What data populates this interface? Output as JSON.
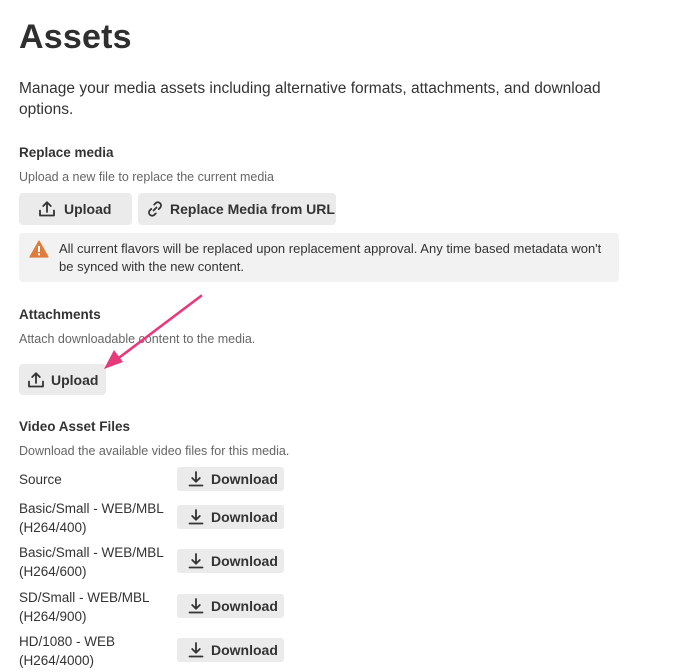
{
  "page": {
    "title": "Assets",
    "description": "Manage your media assets including alternative formats, attachments, and download options."
  },
  "replace_media": {
    "title": "Replace media",
    "description": "Upload a new file to replace the current media",
    "upload_label": "Upload",
    "url_label": "Replace Media from URL",
    "warning": "All current flavors will be replaced upon replacement approval. Any time based metadata won't be synced with the new content."
  },
  "attachments": {
    "title": "Attachments",
    "description": "Attach downloadable content to the media.",
    "upload_label": "Upload"
  },
  "video_files": {
    "title": "Video Asset Files",
    "description": "Download the available video files for this media.",
    "download_label": "Download",
    "files": [
      {
        "name": "Source"
      },
      {
        "name": "Basic/Small - WEB/MBL (H264/400)"
      },
      {
        "name": "Basic/Small - WEB/MBL (H264/600)"
      },
      {
        "name": "SD/Small - WEB/MBL (H264/900)"
      },
      {
        "name": "HD/1080 - WEB (H264/4000)"
      }
    ]
  },
  "icons": {
    "upload": "upload-icon",
    "link": "link-icon",
    "warning": "warning-icon",
    "download": "download-icon",
    "annotation_arrow": "annotation-arrow"
  },
  "colors": {
    "warning": "#e07b3c",
    "annotation": "#e8397d",
    "button_bg": "#ebebeb",
    "alert_bg": "#f2f2f2"
  }
}
